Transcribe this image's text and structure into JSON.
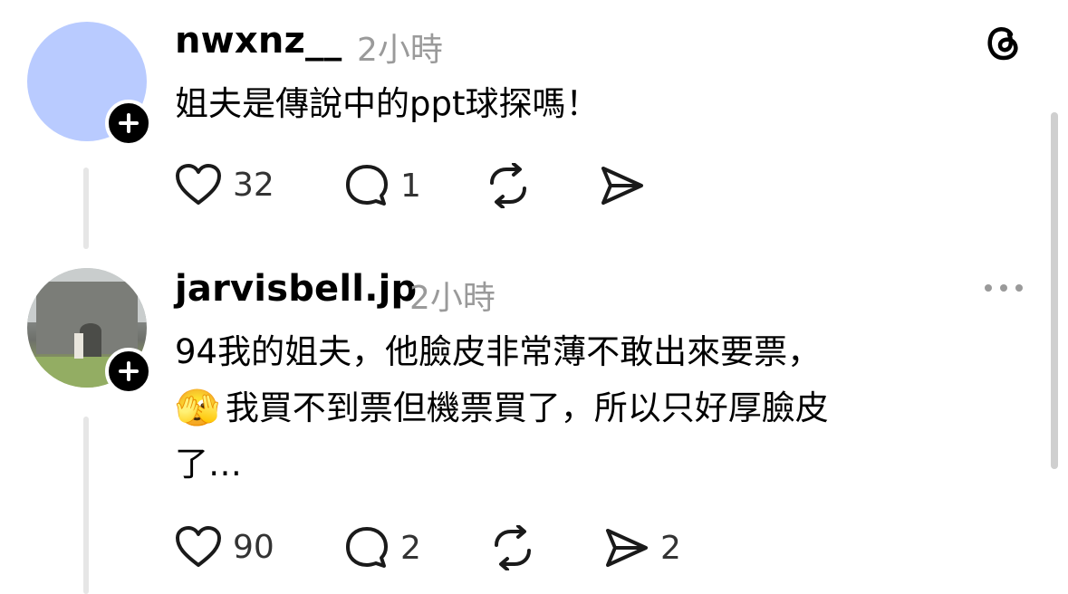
{
  "posts": [
    {
      "username": "nwxnz__",
      "time": "2小時",
      "text": "姐夫是傳說中的ppt球探嗎！",
      "likes": "32",
      "replies": "1",
      "reposts": "",
      "shares": ""
    },
    {
      "username": "jarvisbell.jp",
      "time": "2小時",
      "text_line1": "94我的姐夫，他臉皮非常薄不敢出來要票，",
      "emoji": "🫣",
      "text_line2": "我買不到票但機票買了，所以只好厚臉皮",
      "text_line3": "了…",
      "likes": "90",
      "replies": "2",
      "reposts": "",
      "shares": "2"
    }
  ],
  "icons": {
    "app_logo": "threads-logo-icon",
    "more": "more-options-icon",
    "like": "heart-icon",
    "reply": "comment-icon",
    "repost": "repost-icon",
    "share": "send-icon",
    "follow": "plus-icon"
  },
  "colors": {
    "avatar_bg": "#b9cbff",
    "muted_text": "#9a9a9a"
  }
}
